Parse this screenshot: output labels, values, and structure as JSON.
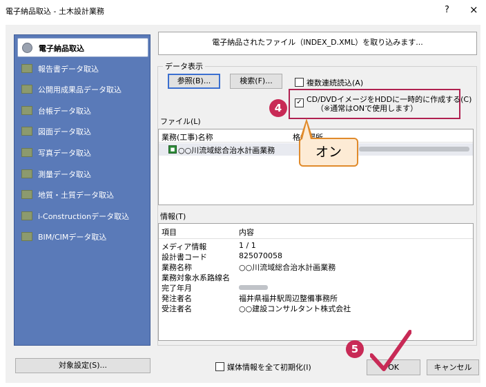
{
  "window": {
    "title": "電子納品取込 - 土木設計業務",
    "help": "?",
    "close": "×"
  },
  "sidebar": {
    "items": [
      {
        "label": "電子納品取込",
        "active": true
      },
      {
        "label": "報告書データ取込"
      },
      {
        "label": "公開用成果品データ取込"
      },
      {
        "label": "台帳データ取込"
      },
      {
        "label": "図面データ取込"
      },
      {
        "label": "写真データ取込"
      },
      {
        "label": "測量データ取込"
      },
      {
        "label": "地質・土質データ取込"
      },
      {
        "label": "i-Constructionデータ取込"
      },
      {
        "label": "BIM/CIMデータ取込"
      }
    ]
  },
  "header": {
    "text": "電子納品されたファイル（INDEX_D.XML）を取り込みます..."
  },
  "data_display": {
    "group_label": "データ表示",
    "browse_button": "参照(B)...",
    "search_button": "検索(F)...",
    "multi_read_checkbox": "複数連続読込(A)",
    "cd_dvd_checkbox_line1": "CD/DVDイメージをHDDに一時的に作成する(C)",
    "cd_dvd_checkbox_line2": "（※通常はONで使用します）",
    "cd_dvd_checked": true
  },
  "annotations": {
    "step4": "4",
    "step5": "5",
    "callout": "オン",
    "accent_red": "#c82a56",
    "callout_border": "#e08a2a"
  },
  "file_list": {
    "label": "ファイル(L)",
    "columns": [
      "業務(工事)名称",
      "格納場所"
    ],
    "rows": [
      {
        "name": "○○川流域総合治水計画業務"
      }
    ]
  },
  "info": {
    "label": "情報(T)",
    "columns": [
      "項目",
      "内容"
    ],
    "rows": [
      {
        "key": "メディア情報",
        "value": "1 / 1"
      },
      {
        "key": "設計書コード",
        "value": "825070058"
      },
      {
        "key": "業務名称",
        "value": "○○川流域総合治水計画業務"
      },
      {
        "key": "業務対象水系路線名",
        "value": ""
      },
      {
        "key": "完了年月",
        "value": ""
      },
      {
        "key": "発注者名",
        "value": "福井県福井駅周辺整備事務所"
      },
      {
        "key": "受注者名",
        "value": "○○建設コンサルタント株式会社"
      }
    ]
  },
  "footer": {
    "target_button": "対象設定(S)...",
    "reset_checkbox": "媒体情報を全て初期化(I)",
    "ok_button": "OK",
    "cancel_button": "キャンセル"
  }
}
